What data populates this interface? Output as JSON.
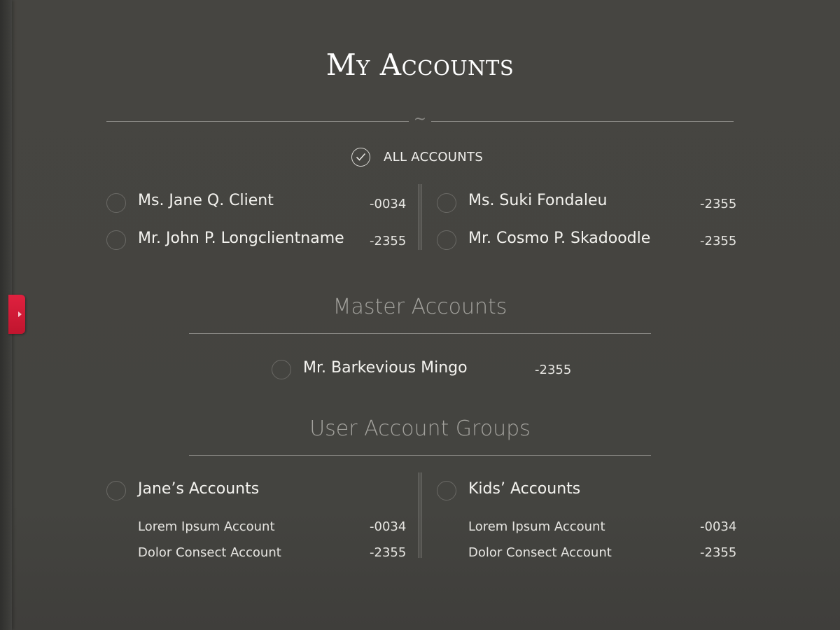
{
  "header": {
    "title": "My Accounts"
  },
  "all_accounts": {
    "label": "ALL ACCOUNTS"
  },
  "accounts": [
    {
      "name": "Ms. Jane Q. Client",
      "number": "-0034"
    },
    {
      "name": "Mr. John P. Longclientname",
      "number": "-2355"
    },
    {
      "name": "Ms. Suki Fondaleu",
      "number": "-2355"
    },
    {
      "name": "Mr. Cosmo P. Skadoodle",
      "number": "-2355"
    }
  ],
  "master": {
    "title": "Master Accounts",
    "accounts": [
      {
        "name": "Mr. Barkevious Mingo",
        "number": "-2355"
      }
    ]
  },
  "groups": {
    "title": "User Account Groups",
    "items": [
      {
        "name": "Jane’s Accounts",
        "accounts": [
          {
            "name": "Lorem Ipsum Account",
            "number": "-0034"
          },
          {
            "name": "Dolor Consect Account",
            "number": "-2355"
          }
        ]
      },
      {
        "name": "Kids’ Accounts",
        "accounts": [
          {
            "name": "Lorem Ipsum Account",
            "number": "-0034"
          },
          {
            "name": "Dolor Consect Account",
            "number": "-2355"
          }
        ]
      }
    ]
  },
  "colors": {
    "accent": "#d21a36",
    "background": "#454440"
  },
  "icons": {
    "check": "check-icon",
    "drawer": "caret-right-icon"
  }
}
